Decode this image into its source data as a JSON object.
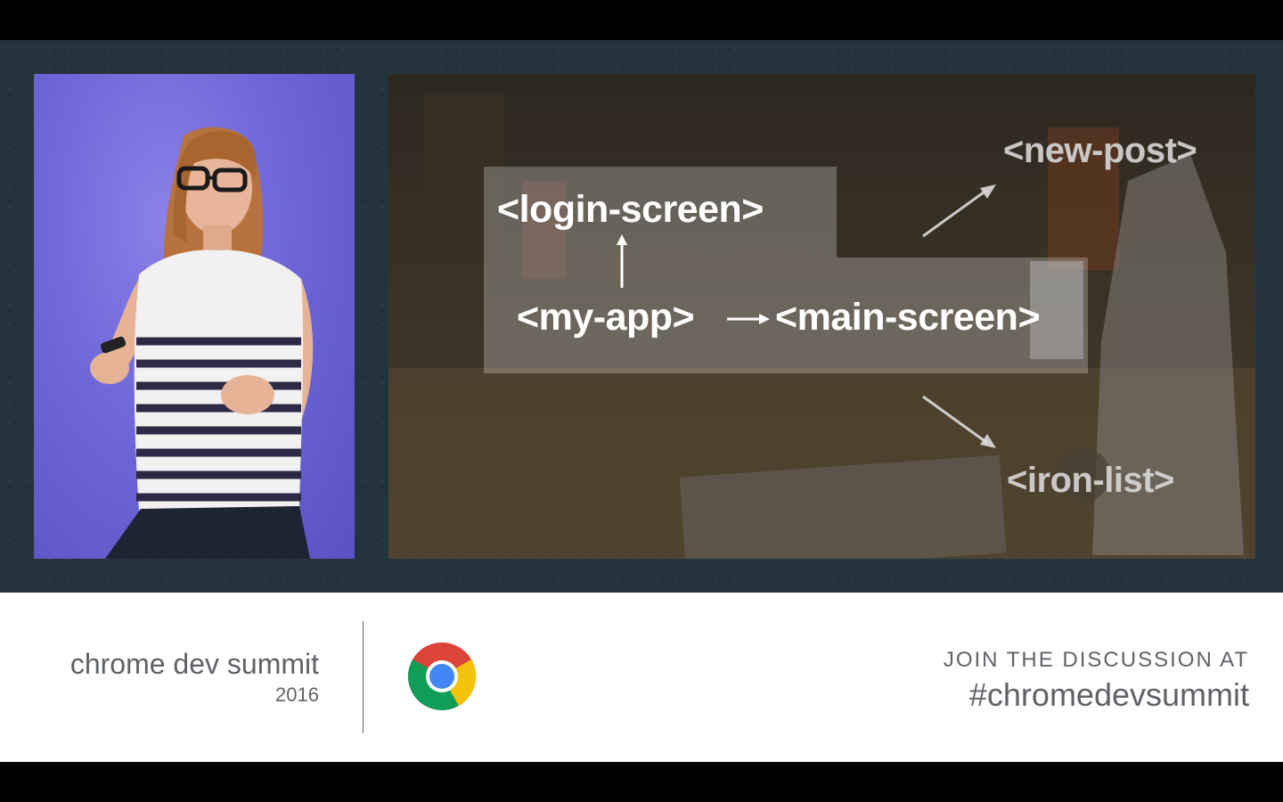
{
  "slide": {
    "nodes": {
      "login": "<login-screen>",
      "app": "<my-app>",
      "main": "<main-screen>",
      "new_post": "<new-post>",
      "iron_list": "<iron-list>"
    }
  },
  "footer": {
    "brand_name": "chrome dev summit",
    "brand_year": "2016",
    "join_text": "JOIN THE DISCUSSION AT",
    "hashtag": "#chromedevsummit"
  },
  "colors": {
    "stage_bg": "#24343c",
    "speaker_bg": "#6f66d8",
    "footer_text": "#5f6368",
    "chrome_red": "#db4437",
    "chrome_yellow": "#f4c20d",
    "chrome_green": "#0f9d58",
    "chrome_blue": "#4285f4"
  }
}
